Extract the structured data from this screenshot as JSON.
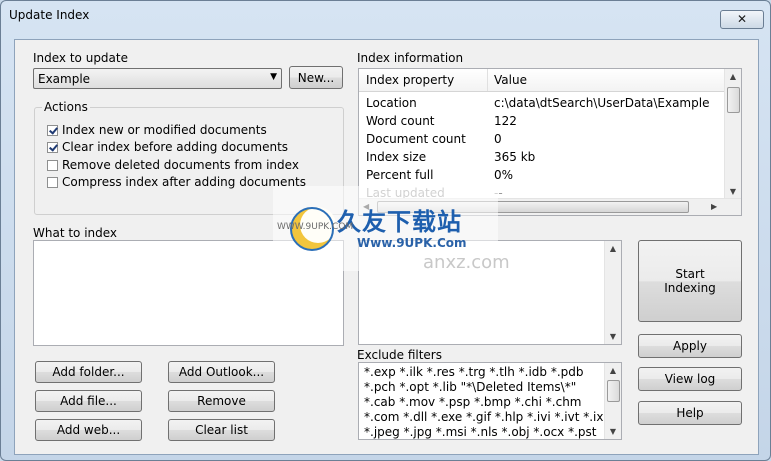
{
  "window": {
    "title": "Update Index",
    "close_glyph": "✕"
  },
  "index_to_update": {
    "label": "Index to update",
    "selected": "Example",
    "new_button": "New..."
  },
  "actions": {
    "title": "Actions",
    "items": [
      {
        "label": "Index new or modified documents",
        "checked": true
      },
      {
        "label": "Clear index before adding documents",
        "checked": true
      },
      {
        "label": "Remove deleted documents from index",
        "checked": false
      },
      {
        "label": "Compress index after adding documents",
        "checked": false
      }
    ]
  },
  "index_info": {
    "label": "Index information",
    "col_property": "Index property",
    "col_value": "Value",
    "rows": [
      {
        "property": "Location",
        "value": "c:\\data\\dtSearch\\UserData\\Example"
      },
      {
        "property": "Word count",
        "value": "122"
      },
      {
        "property": "Document count",
        "value": "0"
      },
      {
        "property": "Index size",
        "value": "365 kb"
      },
      {
        "property": "Percent full",
        "value": "0%"
      },
      {
        "property": "Last updated",
        "value": "--"
      }
    ]
  },
  "what_to_index": {
    "label": "What to index"
  },
  "buttons": {
    "add_folder": "Add folder...",
    "add_outlook": "Add Outlook...",
    "add_file": "Add file...",
    "remove": "Remove",
    "add_web": "Add web...",
    "clear_list": "Clear list",
    "start_line1": "Start",
    "start_line2": "Indexing",
    "apply": "Apply",
    "view_log": "View log",
    "help": "Help"
  },
  "exclude": {
    "label": "Exclude filters",
    "lines": [
      "*.exp *.ilk *.res *.trg *.tlh *.idb *.pdb",
      "*.pch *.opt *.lib \"*\\Deleted Items\\*\"",
      "*.cab *.mov *.psp *.bmp *.chi *.chm",
      "*.com *.dll *.exe *.gif *.hlp *.ivi *.ivt *.ix",
      "*.jpeg *.jpg *.msi *.nls *.obj *.ocx *.pst"
    ]
  },
  "watermark": {
    "brand": "久友下载站",
    "url_left": "WWW.9UPK.COM",
    "url_main": "Www.9UPK.Com",
    "faint": "anxz.com"
  }
}
